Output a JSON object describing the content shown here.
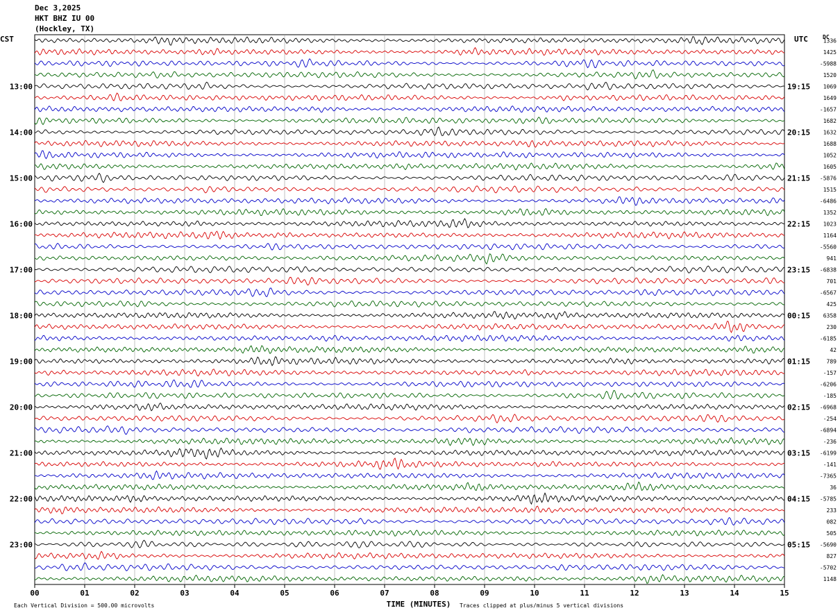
{
  "header": {
    "date": "Dec 3,2025",
    "station": "HKT BHZ IU 00",
    "location": "(Hockley, TX)"
  },
  "left_zone": "CST",
  "right_zone": "UTC",
  "dc_label": "DC",
  "footer": {
    "scale_note": "Each Vertical Division =  500.00 microvolts",
    "clip_note": "Traces clipped at plus/minus 5 vertical divisions"
  },
  "chart_data": {
    "type": "line",
    "title": "HKT BHZ IU 00",
    "xlabel": "TIME (MINUTES)",
    "xlim": [
      0,
      15
    ],
    "x_ticks": [
      "00",
      "01",
      "02",
      "03",
      "04",
      "05",
      "06",
      "07",
      "08",
      "09",
      "10",
      "11",
      "12",
      "13",
      "14",
      "15"
    ],
    "trace_count": 48,
    "minutes_per_trace": 15,
    "trace_colors": [
      "#000000",
      "#d80000",
      "#0000c8",
      "#006400"
    ],
    "hour_labels_cst": [
      "13:00",
      "14:00",
      "15:00",
      "16:00",
      "17:00",
      "18:00",
      "19:00",
      "20:00",
      "21:00",
      "22:00",
      "23:00"
    ],
    "hour_labels_utc": [
      "19:15",
      "20:15",
      "21:15",
      "22:15",
      "23:15",
      "00:15",
      "01:15",
      "02:15",
      "03:15",
      "04:15",
      "05:15"
    ],
    "hour_label_trace_index": [
      4,
      8,
      12,
      16,
      20,
      24,
      28,
      32,
      36,
      40,
      44
    ],
    "dc_offsets": [
      "1336",
      "1425",
      "-5988",
      "1520",
      "1069",
      "1649",
      "-1657",
      "1682",
      "1632",
      "1688",
      "1052",
      "1605",
      "-5876",
      "1515",
      "-6486",
      "1352",
      "1023",
      "1164",
      "-5560",
      "941",
      "-6838",
      "701",
      "-6567",
      "425",
      "6358",
      "230",
      "-6185",
      "42",
      "789",
      "-157",
      "-6206",
      "-185",
      "-6968",
      "-254",
      "-6894",
      "-236",
      "-6199",
      "-141",
      "-7365",
      "36",
      "-5785",
      "233",
      "082",
      "505",
      "-5690",
      "827",
      "-5702",
      "1148"
    ]
  }
}
